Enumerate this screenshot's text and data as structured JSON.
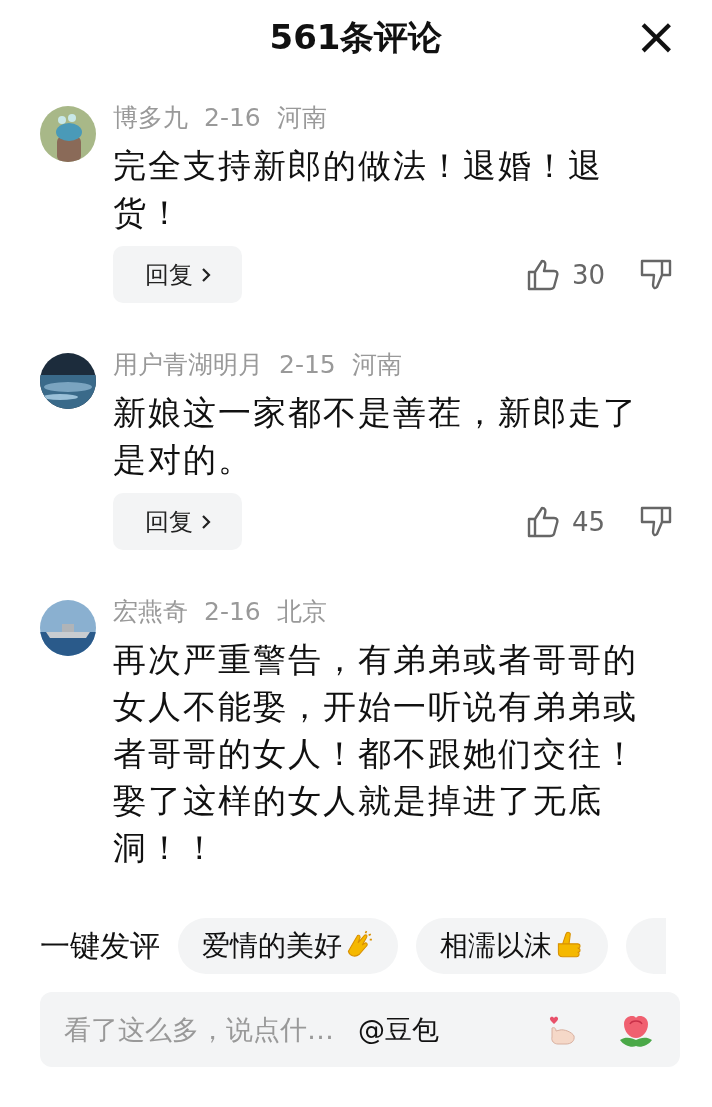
{
  "header": {
    "title": "561条评论",
    "close": "×"
  },
  "comments": [
    {
      "user": "博多九",
      "date": "2-16",
      "location": "河南",
      "text": "完全支持新郎的做法！退婚！退货！",
      "reply": "回复",
      "likes": "30",
      "kind": "cartoon"
    },
    {
      "user": "用户青湖明月",
      "date": "2-15",
      "location": "河南",
      "text": "新娘这一家都不是善茬，新郎走了是对的。",
      "reply": "回复",
      "likes": "45",
      "kind": "sea"
    },
    {
      "user": "宏燕奇",
      "date": "2-16",
      "location": "北京",
      "text": "再次严重警告，有弟弟或者哥哥的女人不能娶，开始一听说有弟弟或者哥哥的女人！都不跟她们交往！娶了这样的女人就是掉进了无底洞！！",
      "kind": "ship"
    }
  ],
  "quick_reply": {
    "label": "一键发评",
    "chips": [
      {
        "text": "爱情的美好",
        "kind": "clap"
      },
      {
        "text": "相濡以沫",
        "kind": "thumb"
      }
    ]
  },
  "input": {
    "placeholder": "看了这么多，说点什…",
    "mention": "@豆包"
  }
}
